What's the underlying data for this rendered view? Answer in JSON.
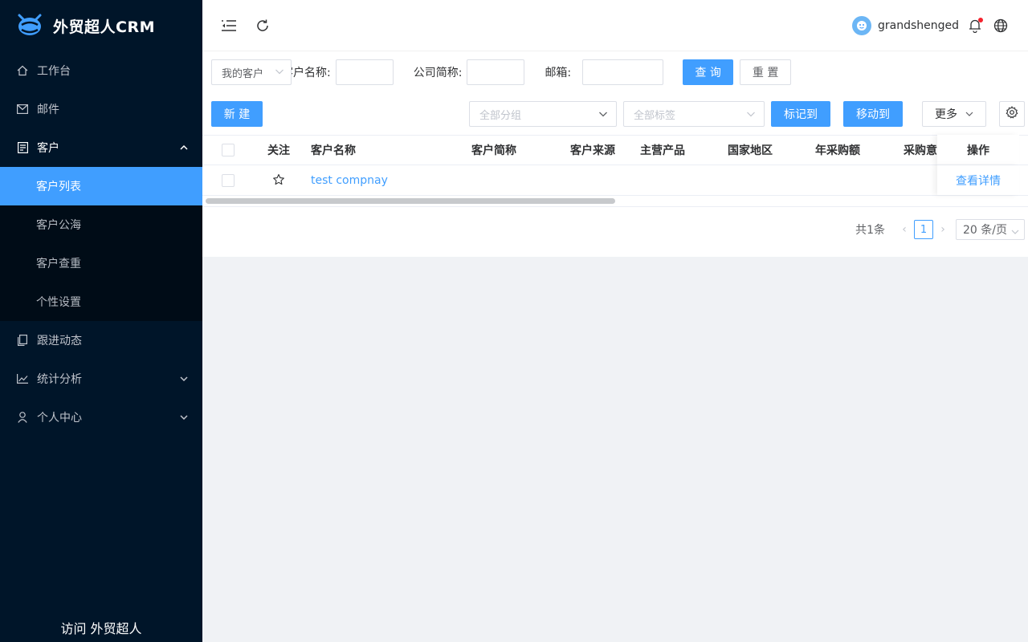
{
  "app": {
    "title": "外贸超人CRM"
  },
  "sidebar": {
    "items": [
      {
        "label": "工作台",
        "icon": "home-icon"
      },
      {
        "label": "邮件",
        "icon": "mail-icon"
      },
      {
        "label": "客户",
        "icon": "customer-icon",
        "expanded": true
      },
      {
        "label": "跟进动态",
        "icon": "copy-icon"
      },
      {
        "label": "统计分析",
        "icon": "chart-icon"
      },
      {
        "label": "个人中心",
        "icon": "user-icon"
      }
    ],
    "submenu": [
      {
        "label": "客户列表",
        "active": true
      },
      {
        "label": "客户公海"
      },
      {
        "label": "客户查重"
      },
      {
        "label": "个性设置"
      }
    ],
    "footer": "访问 外贸超人"
  },
  "topbar": {
    "username": "grandshenged"
  },
  "filters": {
    "scope_value": "我的客户",
    "customer_name_label": "客户名称:",
    "company_short_label": "公司简称:",
    "email_label": "邮箱:",
    "query_button": "查 询",
    "reset_button": "重 置"
  },
  "actions": {
    "new_button": "新 建",
    "group_placeholder": "全部分组",
    "tag_placeholder": "全部标签",
    "mark_button": "标记到",
    "move_button": "移动到",
    "more_button": "更多"
  },
  "table": {
    "headers": {
      "follow": "关注",
      "name": "客户名称",
      "short": "客户简称",
      "source": "客户来源",
      "product": "主营产品",
      "region": "国家地区",
      "annual": "年采购额",
      "intent": "采购意",
      "ops": "操作"
    },
    "rows": [
      {
        "name": "test compnay",
        "action": "查看详情"
      }
    ]
  },
  "pagination": {
    "total": "共1条",
    "current_page": "1",
    "page_size": "20 条/页"
  },
  "colors": {
    "primary": "#409eff",
    "sidebar_bg": "#001529",
    "submenu_bg": "#000c17"
  }
}
